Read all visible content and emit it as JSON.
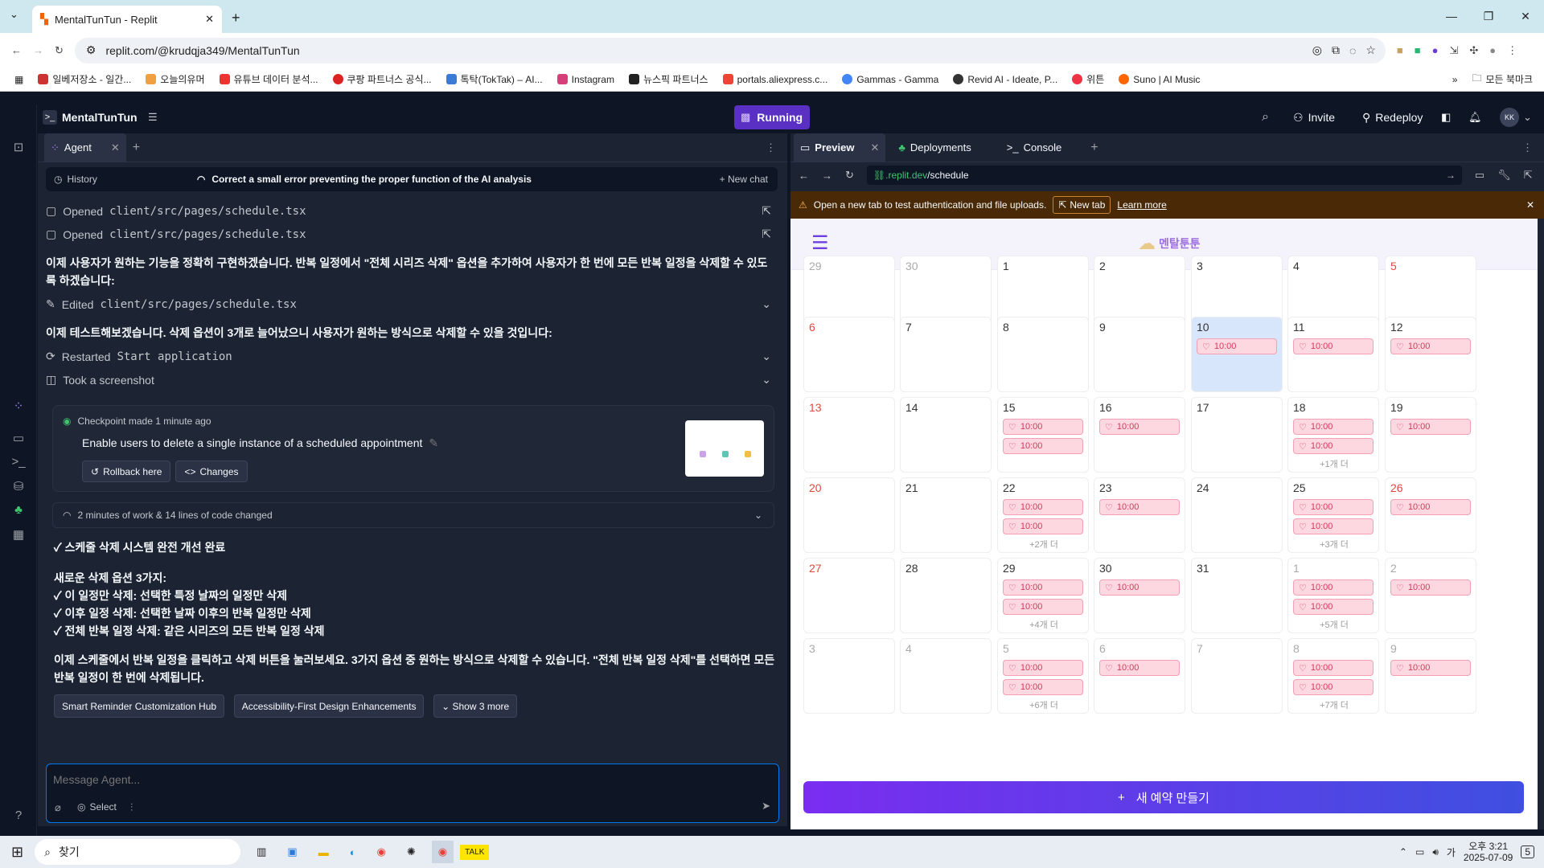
{
  "browser": {
    "tab_title": "MentalTunTun - Replit",
    "url": "replit.com/@krudqja349/MentalTunTun",
    "bookmarks": [
      "일베저장소 - 일간...",
      "오늘의유머",
      "유튜브 데이터 분석...",
      "쿠팡 파트너스 공식...",
      "톡탁(TokTak) – AI...",
      "Instagram",
      "뉴스픽 파트너스",
      "portals.aliexpress.c...",
      "Gammas - Gamma",
      "Revid AI - Ideate, P...",
      "위튼",
      "Suno | AI Music"
    ],
    "bookmarks_folder": "모든 북마크"
  },
  "topbar": {
    "project_name": "MentalTunTun",
    "run_status": "Running",
    "invite": "Invite",
    "redeploy": "Redeploy",
    "avatar_initials": "KK"
  },
  "agent": {
    "tab_label": "Agent",
    "history": "History",
    "thread_title": "Correct a small error preventing the proper function of the AI analysis",
    "new_chat": "New chat",
    "feed": {
      "opened1_prefix": "Opened",
      "opened1_path": "client/src/pages/schedule.tsx",
      "opened2_prefix": "Opened",
      "opened2_path": "client/src/pages/schedule.tsx",
      "para1": "이제 사용자가 원하는 기능을 정확히 구현하겠습니다. 반복 일정에서 \"전체 시리즈 삭제\" 옵션을 추가하여 사용자가 한 번에 모든 반복 일정을 삭제할 수 있도록 하겠습니다:",
      "edited_prefix": "Edited",
      "edited_path": "client/src/pages/schedule.tsx",
      "para2": "이제 테스트해보겠습니다. 삭제 옵션이 3개로 늘어났으니 사용자가 원하는 방식으로 삭제할 수 있을 것입니다:",
      "restarted_prefix": "Restarted",
      "restarted_target": "Start application",
      "screenshot": "Took a screenshot",
      "checkpoint_meta": "Checkpoint made 1 minute ago",
      "checkpoint_title": "Enable users to delete a single instance of a scheduled appointment",
      "rollback": "Rollback here",
      "changes": "Changes",
      "work_summary": "2 minutes of work & 14 lines of code changed",
      "summary_title": "✓ 스케줄 삭제 시스템 완전 개선 완료",
      "options_header": "새로운 삭제 옵션 3가지:",
      "option1": "✓ 이 일정만 삭제: 선택한 특정 날짜의 일정만 삭제",
      "option2": "✓ 이후 일정 삭제: 선택한 날짜 이후의 반복 일정만 삭제",
      "option3": "✓ 전체 반복 일정 삭제: 같은 시리즈의 모든 반복 일정 삭제",
      "closing": "이제 스케줄에서 반복 일정을 클릭하고 삭제 버튼을 눌러보세요. 3가지 옵션 중 원하는 방식으로 삭제할 수 있습니다. \"전체 반복 일정 삭제\"를 선택하면 모든 반복 일정이 한 번에 삭제됩니다.",
      "suggestion1": "Smart Reminder Customization Hub",
      "suggestion2": "Accessibility-First Design Enhancements",
      "show_more": "Show 3 more"
    },
    "input_placeholder": "Message Agent...",
    "select_label": "Select"
  },
  "preview": {
    "tabs": [
      "Preview",
      "Deployments",
      "Console"
    ],
    "url_prefix": ".replit.dev",
    "url_path": "/schedule",
    "banner": "Open a new tab to test authentication and file uploads.",
    "new_tab": "New tab",
    "learn_more": "Learn more",
    "app_logo_text": "멘탈툰툰",
    "create_button": "새 예약 만들기",
    "event_time": "10:00"
  },
  "calendar": {
    "weeks": [
      [
        {
          "d": "29",
          "c": "grey"
        },
        {
          "d": "30",
          "c": "grey"
        },
        {
          "d": "1"
        },
        {
          "d": "2"
        },
        {
          "d": "3"
        },
        {
          "d": "4"
        },
        {
          "d": "5",
          "c": "red"
        }
      ],
      [
        {
          "d": "6",
          "c": "red"
        },
        {
          "d": "7"
        },
        {
          "d": "8"
        },
        {
          "d": "9"
        },
        {
          "d": "10",
          "today": true,
          "ev": 1
        },
        {
          "d": "11",
          "ev": 1
        },
        {
          "d": "12",
          "ev": 1
        }
      ],
      [
        {
          "d": "13",
          "c": "red"
        },
        {
          "d": "14"
        },
        {
          "d": "15",
          "ev": 2
        },
        {
          "d": "16",
          "ev": 1
        },
        {
          "d": "17"
        },
        {
          "d": "18",
          "ev": 2,
          "more": "+1개 더"
        },
        {
          "d": "19",
          "ev": 1
        }
      ],
      [
        {
          "d": "20",
          "c": "red"
        },
        {
          "d": "21"
        },
        {
          "d": "22",
          "ev": 2,
          "more": "+2개 더"
        },
        {
          "d": "23",
          "ev": 1
        },
        {
          "d": "24"
        },
        {
          "d": "25",
          "ev": 2,
          "more": "+3개 더"
        },
        {
          "d": "26",
          "c": "red",
          "ev": 1
        }
      ],
      [
        {
          "d": "27",
          "c": "red"
        },
        {
          "d": "28"
        },
        {
          "d": "29",
          "ev": 2,
          "more": "+4개 더"
        },
        {
          "d": "30",
          "ev": 1
        },
        {
          "d": "31"
        },
        {
          "d": "1",
          "c": "grey",
          "ev": 2,
          "more": "+5개 더"
        },
        {
          "d": "2",
          "c": "grey",
          "ev": 1
        }
      ],
      [
        {
          "d": "3",
          "c": "grey"
        },
        {
          "d": "4",
          "c": "grey"
        },
        {
          "d": "5",
          "c": "grey",
          "ev": 2,
          "more": "+6개 더"
        },
        {
          "d": "6",
          "c": "grey",
          "ev": 1
        },
        {
          "d": "7",
          "c": "grey"
        },
        {
          "d": "8",
          "c": "grey",
          "ev": 2,
          "more": "+7개 더"
        },
        {
          "d": "9",
          "c": "grey",
          "ev": 1
        }
      ]
    ]
  },
  "taskbar": {
    "search_placeholder": "찾기",
    "time": "오후 3:21",
    "date": "2025-07-09",
    "ime": "가",
    "notif_count": "5"
  }
}
